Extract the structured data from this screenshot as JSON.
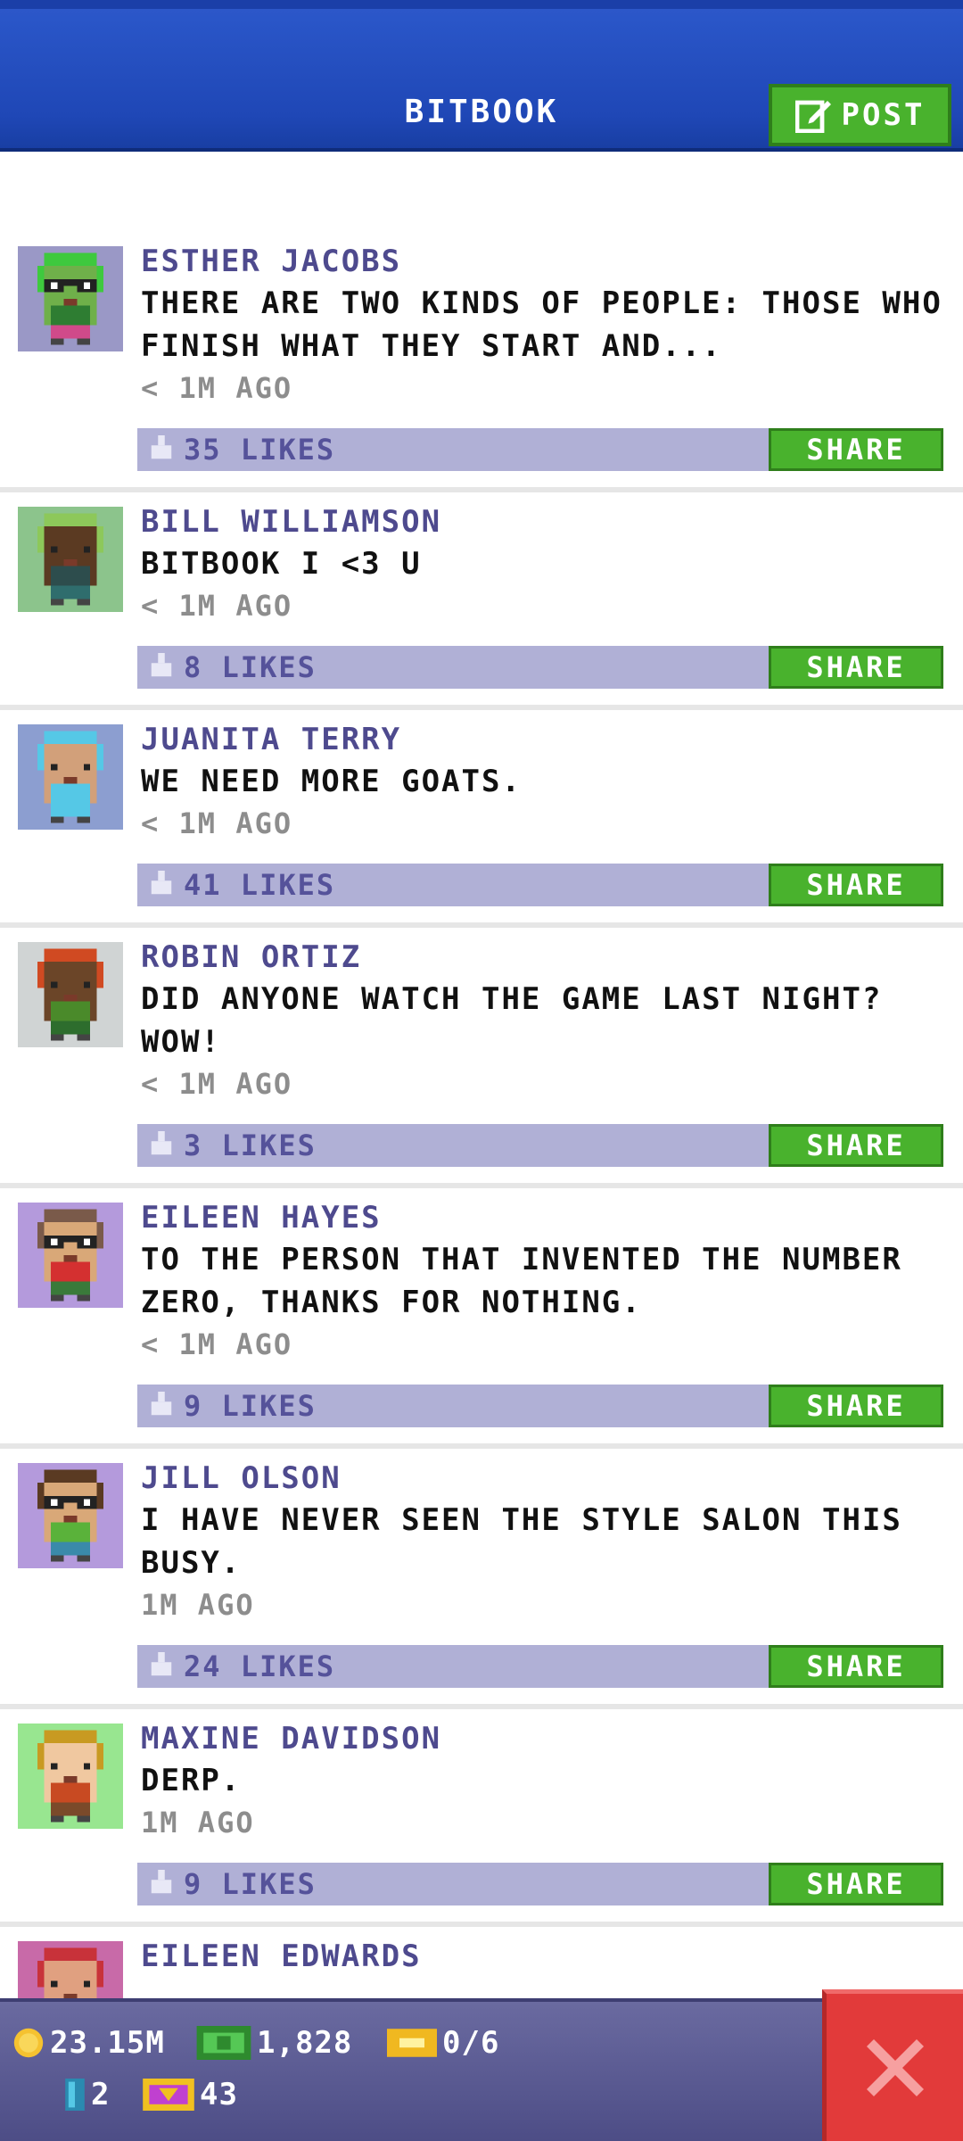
{
  "header": {
    "title": "BITBOOK",
    "post_label": "POST"
  },
  "share_label": "SHARE",
  "posts": [
    {
      "name": "ESTHER JACOBS",
      "text": "THERE ARE TWO KINDS OF PEOPLE: THOSE WHO FINISH WHAT THEY START AND...",
      "time": "< 1M AGO",
      "likes": "35 LIKES",
      "avatar_bg": "#9a98c6",
      "skin": "#6fb04a",
      "hair": "#3ec93e",
      "shirt": "#2e7d32",
      "pants": "#d04a8a",
      "glasses": true
    },
    {
      "name": "BILL WILLIAMSON",
      "text": "BITBOOK I <3 U",
      "time": "< 1M AGO",
      "likes": "8 LIKES",
      "avatar_bg": "#8cc48c",
      "skin": "#5b3a22",
      "hair": "#8dc85a",
      "shirt": "#2d4d4d",
      "pants": "#2f6d6d",
      "glasses": false
    },
    {
      "name": "JUANITA TERRY",
      "text": "WE NEED MORE GOATS.",
      "time": "< 1M AGO",
      "likes": "41 LIKES",
      "avatar_bg": "#8c9ed0",
      "skin": "#d2a07a",
      "hair": "#55c8e6",
      "shirt": "#55c8e6",
      "pants": "#55c8e6",
      "glasses": false
    },
    {
      "name": "ROBIN ORTIZ",
      "text": "DID ANYONE WATCH THE GAME LAST NIGHT? WOW!",
      "time": "< 1M AGO",
      "likes": "3 LIKES",
      "avatar_bg": "#d0d4d4",
      "skin": "#6b4528",
      "hair": "#d04a22",
      "shirt": "#4a8a2a",
      "pants": "#2d6d2d",
      "glasses": false
    },
    {
      "name": "EILEEN HAYES",
      "text": "TO THE PERSON THAT INVENTED THE NUMBER ZERO, THANKS FOR NOTHING.",
      "time": "< 1M AGO",
      "likes": "9 LIKES",
      "avatar_bg": "#b49adc",
      "skin": "#d9a878",
      "hair": "#7a5a4a",
      "shirt": "#d43030",
      "pants": "#3a7a3a",
      "glasses": true
    },
    {
      "name": "JILL OLSON",
      "text": "I HAVE NEVER SEEN THE STYLE SALON THIS BUSY.",
      "time": "1M AGO",
      "likes": "24 LIKES",
      "avatar_bg": "#b49adc",
      "skin": "#d9a878",
      "hair": "#5a3a22",
      "shirt": "#5ab23a",
      "pants": "#3a8aaa",
      "glasses": true
    },
    {
      "name": "MAXINE DAVIDSON",
      "text": "DERP.",
      "time": "1M AGO",
      "likes": "9 LIKES",
      "avatar_bg": "#98e690",
      "skin": "#f0c8a0",
      "hair": "#c89a22",
      "shirt": "#c84a22",
      "pants": "#7a4a2a",
      "glasses": false
    },
    {
      "name": "EILEEN EDWARDS",
      "text": "",
      "time": "",
      "likes": "",
      "avatar_bg": "#c86aa8",
      "skin": "#e0a080",
      "hair": "#c8323a",
      "shirt": "#c8323a",
      "pants": "#c8323a",
      "glasses": false
    }
  ],
  "bottom": {
    "coins": "23.15M",
    "bux": "1,828",
    "tickets": "0/6",
    "bitizens": "2",
    "vip": "43"
  }
}
